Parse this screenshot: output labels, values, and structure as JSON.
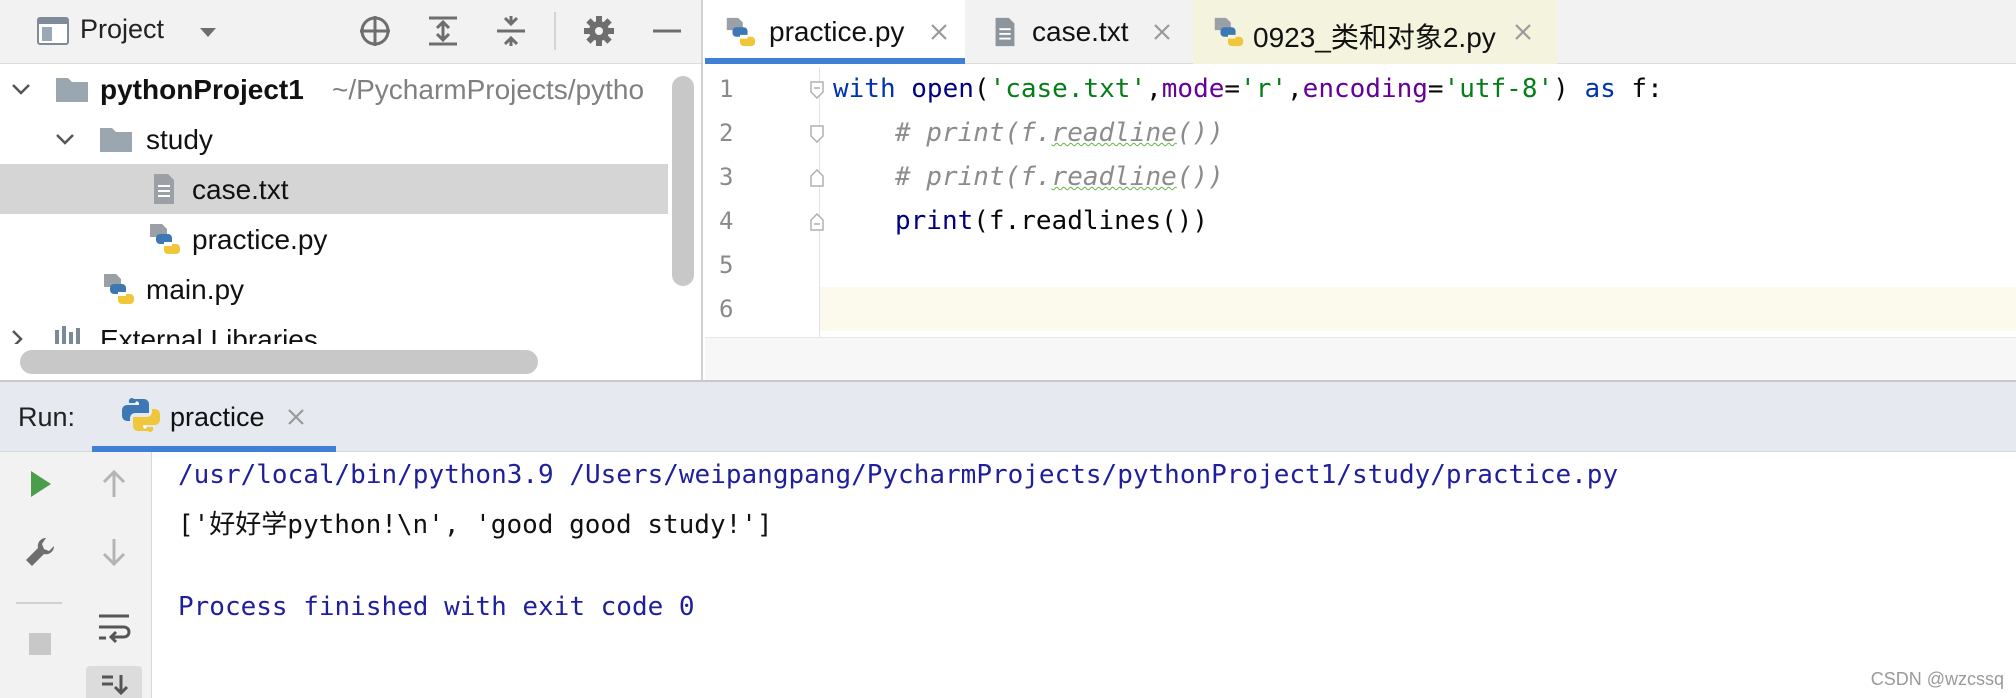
{
  "project_panel": {
    "title": "Project",
    "header_icons": [
      "select-opened-file-icon",
      "expand-all-icon",
      "collapse-all-icon",
      "settings-icon",
      "hide-icon"
    ],
    "tree": [
      {
        "label": "pythonProject1",
        "sublabel": "~/PycharmProjects/pytho",
        "type": "folder",
        "expanded": true
      },
      {
        "label": "study",
        "type": "folder",
        "expanded": true
      },
      {
        "label": "case.txt",
        "type": "text-file",
        "selected": true
      },
      {
        "label": "practice.py",
        "type": "python-file"
      },
      {
        "label": "main.py",
        "type": "python-file"
      },
      {
        "label": "External Libraries",
        "type": "libraries",
        "expanded": false
      }
    ]
  },
  "editor": {
    "tabs": [
      {
        "label": "practice.py",
        "icon": "python-file-icon",
        "active": true
      },
      {
        "label": "case.txt",
        "icon": "text-file-icon",
        "active": false
      },
      {
        "label": "0923_类和对象2.py",
        "icon": "python-file-icon",
        "active": false
      }
    ],
    "line_numbers": [
      "1",
      "2",
      "3",
      "4",
      "5",
      "6"
    ],
    "code": {
      "l1": {
        "kw_with": "with",
        "fn_open": "open",
        "p1": "(",
        "s1": "'case.txt'",
        "c1": ",",
        "k_mode": "mode",
        "eq1": "=",
        "s2": "'r'",
        "c2": ",",
        "k_enc": "encoding",
        "eq2": "=",
        "s3": "'utf-8'",
        "p2": ") ",
        "kw_as": "as",
        "tail": " f:"
      },
      "l2": {
        "pre": "# print(f.",
        "typo": "readline",
        "post": "())"
      },
      "l3": {
        "pre": "# print(f.",
        "typo": "readline",
        "post": "())"
      },
      "l4": {
        "fn": "print",
        "rest": "(f.readlines())"
      }
    }
  },
  "run_panel": {
    "title": "Run:",
    "tab_label": "practice",
    "toolbar_icons": [
      "rerun-icon",
      "scroll-up-icon",
      "settings-wrench-icon",
      "scroll-down-icon",
      "stop-icon",
      "soft-wrap-icon",
      "scroll-to-end-icon"
    ],
    "console": {
      "command": "/usr/local/bin/python3.9 /Users/weipangpang/PycharmProjects/pythonProject1/study/practice.py",
      "output": "['好好学python!\\n', 'good good study!']",
      "blank": "",
      "exit": "Process finished with exit code 0"
    }
  },
  "watermark": "CSDN @wzcssq",
  "colors": {
    "accent": "#3f7fd6",
    "keyword": "#0033b3",
    "string": "#067d17",
    "param": "#660099",
    "comment": "#8c8c8c",
    "console_system": "#1f1f9e",
    "selection": "#d5d5d5",
    "run_green": "#4a9d4a"
  }
}
